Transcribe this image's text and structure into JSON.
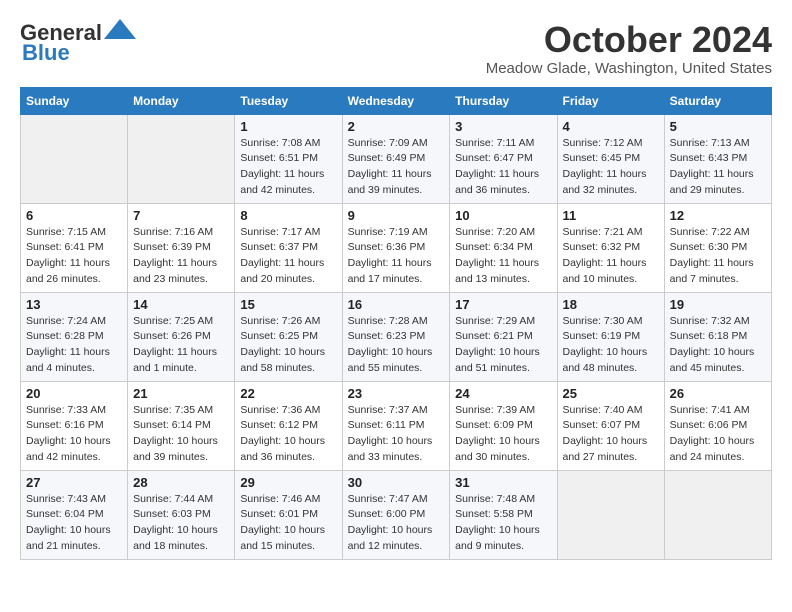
{
  "header": {
    "logo_line1": "General",
    "logo_line2": "Blue",
    "month": "October 2024",
    "location": "Meadow Glade, Washington, United States"
  },
  "weekdays": [
    "Sunday",
    "Monday",
    "Tuesday",
    "Wednesday",
    "Thursday",
    "Friday",
    "Saturday"
  ],
  "weeks": [
    [
      {
        "day": "",
        "detail": ""
      },
      {
        "day": "",
        "detail": ""
      },
      {
        "day": "1",
        "detail": "Sunrise: 7:08 AM\nSunset: 6:51 PM\nDaylight: 11 hours and 42 minutes."
      },
      {
        "day": "2",
        "detail": "Sunrise: 7:09 AM\nSunset: 6:49 PM\nDaylight: 11 hours and 39 minutes."
      },
      {
        "day": "3",
        "detail": "Sunrise: 7:11 AM\nSunset: 6:47 PM\nDaylight: 11 hours and 36 minutes."
      },
      {
        "day": "4",
        "detail": "Sunrise: 7:12 AM\nSunset: 6:45 PM\nDaylight: 11 hours and 32 minutes."
      },
      {
        "day": "5",
        "detail": "Sunrise: 7:13 AM\nSunset: 6:43 PM\nDaylight: 11 hours and 29 minutes."
      }
    ],
    [
      {
        "day": "6",
        "detail": "Sunrise: 7:15 AM\nSunset: 6:41 PM\nDaylight: 11 hours and 26 minutes."
      },
      {
        "day": "7",
        "detail": "Sunrise: 7:16 AM\nSunset: 6:39 PM\nDaylight: 11 hours and 23 minutes."
      },
      {
        "day": "8",
        "detail": "Sunrise: 7:17 AM\nSunset: 6:37 PM\nDaylight: 11 hours and 20 minutes."
      },
      {
        "day": "9",
        "detail": "Sunrise: 7:19 AM\nSunset: 6:36 PM\nDaylight: 11 hours and 17 minutes."
      },
      {
        "day": "10",
        "detail": "Sunrise: 7:20 AM\nSunset: 6:34 PM\nDaylight: 11 hours and 13 minutes."
      },
      {
        "day": "11",
        "detail": "Sunrise: 7:21 AM\nSunset: 6:32 PM\nDaylight: 11 hours and 10 minutes."
      },
      {
        "day": "12",
        "detail": "Sunrise: 7:22 AM\nSunset: 6:30 PM\nDaylight: 11 hours and 7 minutes."
      }
    ],
    [
      {
        "day": "13",
        "detail": "Sunrise: 7:24 AM\nSunset: 6:28 PM\nDaylight: 11 hours and 4 minutes."
      },
      {
        "day": "14",
        "detail": "Sunrise: 7:25 AM\nSunset: 6:26 PM\nDaylight: 11 hours and 1 minute."
      },
      {
        "day": "15",
        "detail": "Sunrise: 7:26 AM\nSunset: 6:25 PM\nDaylight: 10 hours and 58 minutes."
      },
      {
        "day": "16",
        "detail": "Sunrise: 7:28 AM\nSunset: 6:23 PM\nDaylight: 10 hours and 55 minutes."
      },
      {
        "day": "17",
        "detail": "Sunrise: 7:29 AM\nSunset: 6:21 PM\nDaylight: 10 hours and 51 minutes."
      },
      {
        "day": "18",
        "detail": "Sunrise: 7:30 AM\nSunset: 6:19 PM\nDaylight: 10 hours and 48 minutes."
      },
      {
        "day": "19",
        "detail": "Sunrise: 7:32 AM\nSunset: 6:18 PM\nDaylight: 10 hours and 45 minutes."
      }
    ],
    [
      {
        "day": "20",
        "detail": "Sunrise: 7:33 AM\nSunset: 6:16 PM\nDaylight: 10 hours and 42 minutes."
      },
      {
        "day": "21",
        "detail": "Sunrise: 7:35 AM\nSunset: 6:14 PM\nDaylight: 10 hours and 39 minutes."
      },
      {
        "day": "22",
        "detail": "Sunrise: 7:36 AM\nSunset: 6:12 PM\nDaylight: 10 hours and 36 minutes."
      },
      {
        "day": "23",
        "detail": "Sunrise: 7:37 AM\nSunset: 6:11 PM\nDaylight: 10 hours and 33 minutes."
      },
      {
        "day": "24",
        "detail": "Sunrise: 7:39 AM\nSunset: 6:09 PM\nDaylight: 10 hours and 30 minutes."
      },
      {
        "day": "25",
        "detail": "Sunrise: 7:40 AM\nSunset: 6:07 PM\nDaylight: 10 hours and 27 minutes."
      },
      {
        "day": "26",
        "detail": "Sunrise: 7:41 AM\nSunset: 6:06 PM\nDaylight: 10 hours and 24 minutes."
      }
    ],
    [
      {
        "day": "27",
        "detail": "Sunrise: 7:43 AM\nSunset: 6:04 PM\nDaylight: 10 hours and 21 minutes."
      },
      {
        "day": "28",
        "detail": "Sunrise: 7:44 AM\nSunset: 6:03 PM\nDaylight: 10 hours and 18 minutes."
      },
      {
        "day": "29",
        "detail": "Sunrise: 7:46 AM\nSunset: 6:01 PM\nDaylight: 10 hours and 15 minutes."
      },
      {
        "day": "30",
        "detail": "Sunrise: 7:47 AM\nSunset: 6:00 PM\nDaylight: 10 hours and 12 minutes."
      },
      {
        "day": "31",
        "detail": "Sunrise: 7:48 AM\nSunset: 5:58 PM\nDaylight: 10 hours and 9 minutes."
      },
      {
        "day": "",
        "detail": ""
      },
      {
        "day": "",
        "detail": ""
      }
    ]
  ]
}
